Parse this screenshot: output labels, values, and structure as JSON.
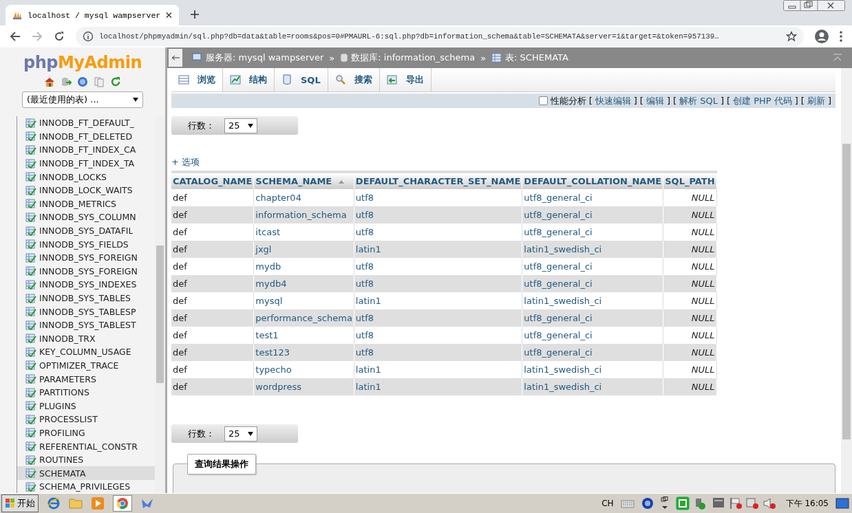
{
  "browser": {
    "tab_title": "localhost / mysql wampserver",
    "url": "localhost/phpmyadmin/sql.php?db=data&table=rooms&pos=0#PMAURL-6:sql.php?db=information_schema&table=SCHEMATA&server=1&target=&token=957139…"
  },
  "sidebar": {
    "logo_php": "php",
    "logo_myadmin": "MyAdmin",
    "recent_select": "(最近使用的表) ...",
    "items": [
      {
        "label": "INNODB_FT_DEFAULT_",
        "selected": false
      },
      {
        "label": "INNODB_FT_DELETED",
        "selected": false
      },
      {
        "label": "INNODB_FT_INDEX_CA",
        "selected": false
      },
      {
        "label": "INNODB_FT_INDEX_TA",
        "selected": false
      },
      {
        "label": "INNODB_LOCKS",
        "selected": false
      },
      {
        "label": "INNODB_LOCK_WAITS",
        "selected": false
      },
      {
        "label": "INNODB_METRICS",
        "selected": false
      },
      {
        "label": "INNODB_SYS_COLUMN",
        "selected": false
      },
      {
        "label": "INNODB_SYS_DATAFIL",
        "selected": false
      },
      {
        "label": "INNODB_SYS_FIELDS",
        "selected": false
      },
      {
        "label": "INNODB_SYS_FOREIGN",
        "selected": false
      },
      {
        "label": "INNODB_SYS_FOREIGN",
        "selected": false
      },
      {
        "label": "INNODB_SYS_INDEXES",
        "selected": false
      },
      {
        "label": "INNODB_SYS_TABLES",
        "selected": false
      },
      {
        "label": "INNODB_SYS_TABLESP",
        "selected": false
      },
      {
        "label": "INNODB_SYS_TABLEST",
        "selected": false
      },
      {
        "label": "INNODB_TRX",
        "selected": false
      },
      {
        "label": "KEY_COLUMN_USAGE",
        "selected": false
      },
      {
        "label": "OPTIMIZER_TRACE",
        "selected": false
      },
      {
        "label": "PARAMETERS",
        "selected": false
      },
      {
        "label": "PARTITIONS",
        "selected": false
      },
      {
        "label": "PLUGINS",
        "selected": false
      },
      {
        "label": "PROCESSLIST",
        "selected": false
      },
      {
        "label": "PROFILING",
        "selected": false
      },
      {
        "label": "REFERENTIAL_CONSTR",
        "selected": false
      },
      {
        "label": "ROUTINES",
        "selected": false
      },
      {
        "label": "SCHEMATA",
        "selected": true
      },
      {
        "label": "SCHEMA_PRIVILEGES",
        "selected": false
      }
    ]
  },
  "breadcrumb": [
    {
      "kind": "server",
      "text": "服务器: mysql wampserver"
    },
    {
      "kind": "separator",
      "text": "»"
    },
    {
      "kind": "database",
      "text": "数据库: information_schema"
    },
    {
      "kind": "separator",
      "text": "»"
    },
    {
      "kind": "table",
      "text": "表: SCHEMATA"
    }
  ],
  "tabs": [
    {
      "label": "浏览",
      "kind": "browse",
      "selected": true
    },
    {
      "label": "结构",
      "kind": "structure",
      "selected": false
    },
    {
      "label": "SQL",
      "kind": "sql",
      "selected": false
    },
    {
      "label": "搜索",
      "kind": "search",
      "selected": false
    },
    {
      "label": "导出",
      "kind": "export",
      "selected": false
    }
  ],
  "toolbar": {
    "profiling": {
      "label": "性能分析",
      "checked": false
    },
    "links": [
      {
        "kind": "bracket",
        "text": "["
      },
      {
        "kind": "link",
        "text": "快速编辑"
      },
      {
        "kind": "bracket",
        "text": "]"
      },
      {
        "kind": "bracket",
        "text": "["
      },
      {
        "kind": "link",
        "text": "编辑"
      },
      {
        "kind": "bracket",
        "text": "]"
      },
      {
        "kind": "bracket",
        "text": "["
      },
      {
        "kind": "link",
        "text": "解析 SQL"
      },
      {
        "kind": "bracket",
        "text": "]"
      },
      {
        "kind": "bracket",
        "text": "["
      },
      {
        "kind": "link",
        "text": "创建 PHP 代码"
      },
      {
        "kind": "bracket",
        "text": "]"
      },
      {
        "kind": "bracket",
        "text": "["
      },
      {
        "kind": "link",
        "text": "刷新"
      },
      {
        "kind": "bracket",
        "text": "]"
      }
    ]
  },
  "row_count": {
    "label": "行数：",
    "value": "25"
  },
  "options_link": "+ 选项",
  "table": {
    "columns": [
      {
        "label": "CATALOG_NAME",
        "sorted": false
      },
      {
        "label": "SCHEMA_NAME",
        "sorted": true
      },
      {
        "label": "DEFAULT_CHARACTER_SET_NAME",
        "sorted": false
      },
      {
        "label": "DEFAULT_COLLATION_NAME",
        "sorted": false
      },
      {
        "label": "SQL_PATH",
        "sorted": false
      }
    ],
    "rows": [
      [
        "def",
        "chapter04",
        "utf8",
        "utf8_general_ci",
        "NULL"
      ],
      [
        "def",
        "information_schema",
        "utf8",
        "utf8_general_ci",
        "NULL"
      ],
      [
        "def",
        "itcast",
        "utf8",
        "utf8_general_ci",
        "NULL"
      ],
      [
        "def",
        "jxgl",
        "latin1",
        "latin1_swedish_ci",
        "NULL"
      ],
      [
        "def",
        "mydb",
        "utf8",
        "utf8_general_ci",
        "NULL"
      ],
      [
        "def",
        "mydb4",
        "utf8",
        "utf8_general_ci",
        "NULL"
      ],
      [
        "def",
        "mysql",
        "latin1",
        "latin1_swedish_ci",
        "NULL"
      ],
      [
        "def",
        "performance_schema",
        "utf8",
        "utf8_general_ci",
        "NULL"
      ],
      [
        "def",
        "test1",
        "utf8",
        "utf8_general_ci",
        "NULL"
      ],
      [
        "def",
        "test123",
        "utf8",
        "utf8_general_ci",
        "NULL"
      ],
      [
        "def",
        "typecho",
        "latin1",
        "latin1_swedish_ci",
        "NULL"
      ],
      [
        "def",
        "wordpress",
        "latin1",
        "latin1_swedish_ci",
        "NULL"
      ]
    ]
  },
  "row_count_bottom": {
    "label": "行数：",
    "value": "25"
  },
  "query_ops_legend": "查询结果操作",
  "taskbar": {
    "start": "开始",
    "lang": "CH",
    "clock": "下午 16:05"
  }
}
